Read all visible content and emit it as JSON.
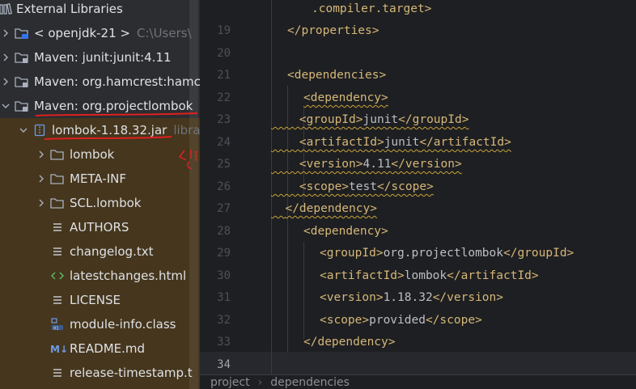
{
  "tree": {
    "header": "External Libraries",
    "items": [
      {
        "label": "< openjdk-21 >",
        "extra": "C:\\Users\\"
      },
      {
        "label": "Maven: junit:junit:4.11"
      },
      {
        "label": "Maven: org.hamcrest:hamc"
      },
      {
        "label": "Maven: org.projectlombok"
      },
      {
        "label": "lombok-1.18.32.jar",
        "extra": "libra"
      },
      {
        "label": "lombok"
      },
      {
        "label": "META-INF"
      },
      {
        "label": "SCL.lombok"
      },
      {
        "label": "AUTHORS"
      },
      {
        "label": "changelog.txt"
      },
      {
        "label": "latestchanges.html"
      },
      {
        "label": "LICENSE"
      },
      {
        "label": "module-info.class"
      },
      {
        "label": "README.md"
      },
      {
        "label": "release-timestamp.t"
      }
    ],
    "colors": {
      "panel": "#2b2d30",
      "highlight": "#45361d",
      "folder": "#a9b1bf",
      "annotation": "#e02020"
    }
  },
  "editor": {
    "line_numbers": [
      "19",
      "20",
      "21",
      "22",
      "23",
      "24",
      "25",
      "26",
      "27",
      "28",
      "29",
      "30",
      "31",
      "32",
      "33",
      "34"
    ],
    "partial_top": ".compiler.target>",
    "code": {
      "l19": "</properties>",
      "l21": "<dependencies>",
      "l22": "<dependency>",
      "l23_open": "<groupId>",
      "l23_val": "junit",
      "l23_close": "</groupId>",
      "l24_open": "<artifactId>",
      "l24_val": "junit",
      "l24_close": "</artifactId>",
      "l25_open": "<version>",
      "l25_val": "4.11",
      "l25_close": "</version>",
      "l26_open": "<scope>",
      "l26_val": "test",
      "l26_close": "</scope>",
      "l27": "</dependency>",
      "l28": "<dependency>",
      "l29_open": "<groupId>",
      "l29_val": "org.projectlombok",
      "l29_close": "</groupId>",
      "l30_open": "<artifactId>",
      "l30_val": "lombok",
      "l30_close": "</artifactId>",
      "l31_open": "<version>",
      "l31_val": "1.18.32",
      "l31_close": "</version>",
      "l32_open": "<scope>",
      "l32_val": "provided",
      "l32_close": "</scope>",
      "l33": "</dependency>"
    },
    "breadcrumb": [
      "project",
      "dependencies"
    ],
    "colors": {
      "tag": "#d5b778",
      "text": "#bcbec4",
      "warning_underline": "#c8a43a"
    }
  }
}
